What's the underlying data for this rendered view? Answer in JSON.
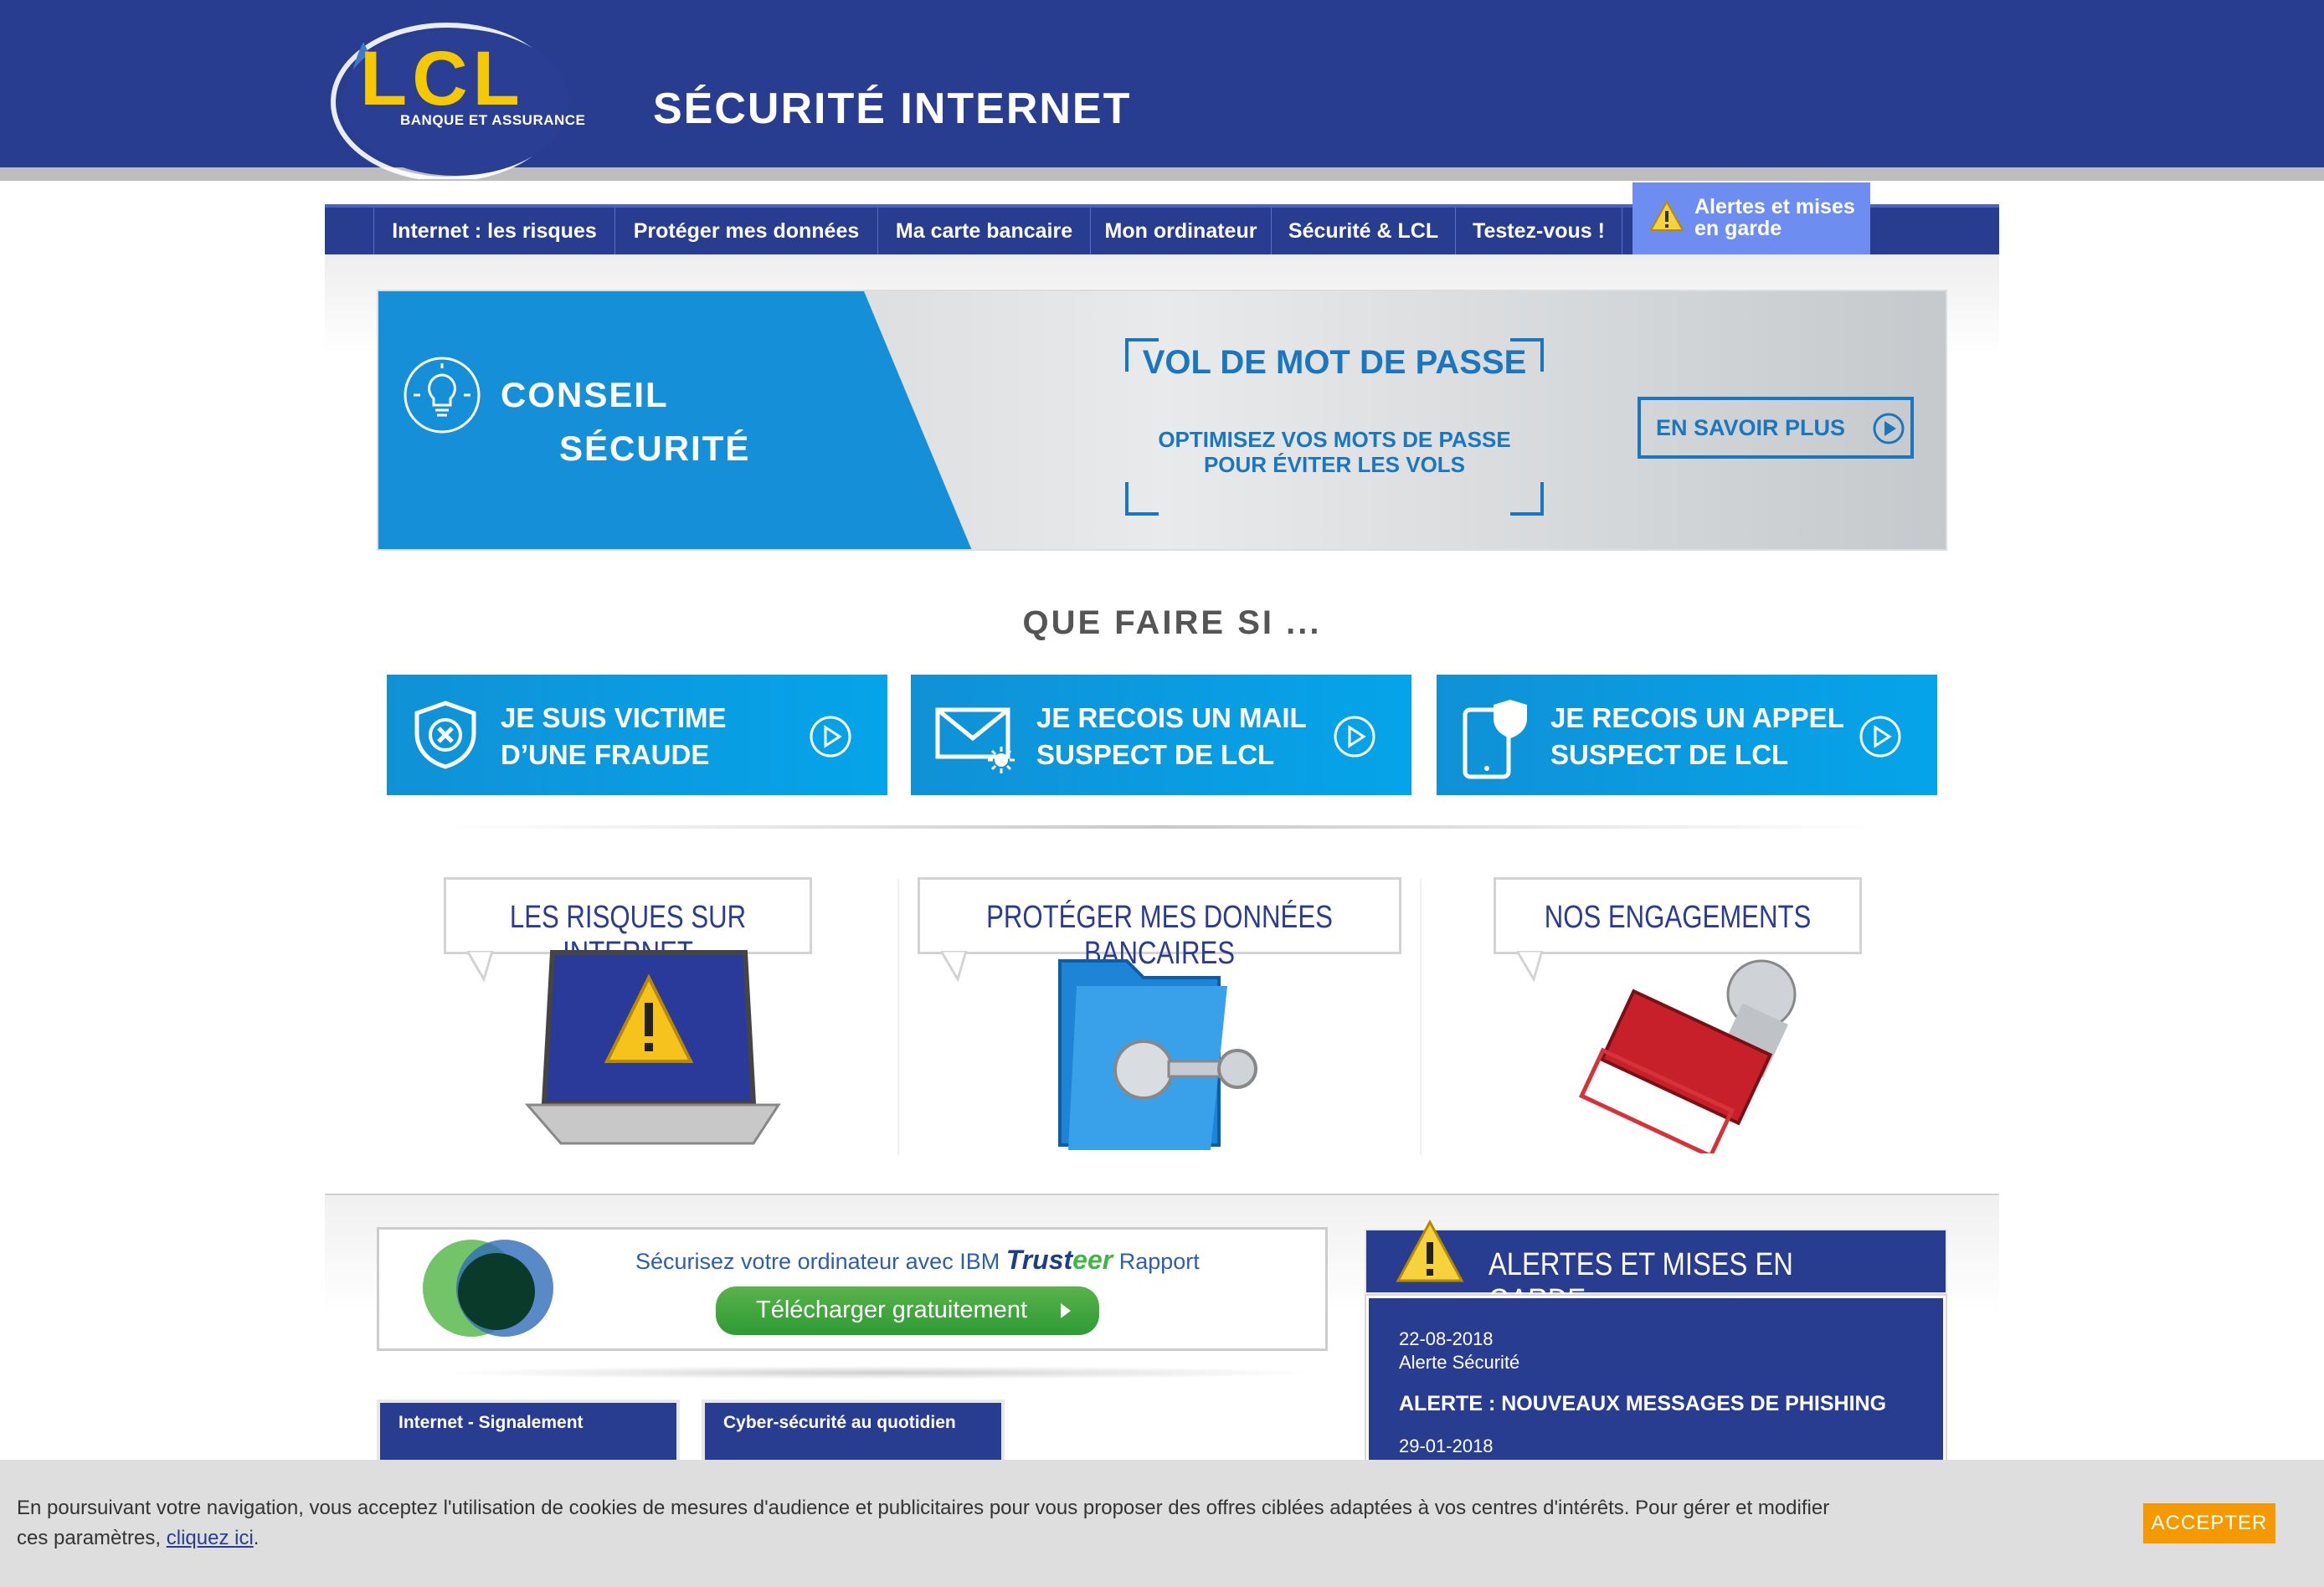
{
  "header": {
    "logo_text": "LCL",
    "logo_subtitle": "BANQUE ET ASSURANCE",
    "title": "SÉCURITÉ INTERNET"
  },
  "nav": {
    "items": [
      {
        "label": "Internet : les risques"
      },
      {
        "label": "Protéger mes données"
      },
      {
        "label": "Ma carte bancaire"
      },
      {
        "label": "Mon ordinateur"
      },
      {
        "label": "Sécurité & LCL"
      },
      {
        "label": "Testez-vous !"
      }
    ],
    "alert_label": "Alertes et mises en garde"
  },
  "banner": {
    "line1": "CONSEIL",
    "line2": "SÉCURITÉ",
    "headline": "VOL DE MOT DE PASSE",
    "subline": "OPTIMISEZ VOS MOTS DE PASSE POUR ÉVITER LES VOLS",
    "cta": "EN SAVOIR PLUS",
    "colors": {
      "blue": "#148fd8",
      "text_blue": "#1a77bf"
    }
  },
  "que_faire": {
    "title": "QUE FAIRE SI ...",
    "buttons": [
      {
        "line1": "JE SUIS VICTIME",
        "line2": "D’UNE FRAUDE",
        "icon": "shield-x-icon"
      },
      {
        "line1": "JE RECOIS UN MAIL",
        "line2": "SUSPECT DE LCL",
        "icon": "mail-icon"
      },
      {
        "line1": "JE RECOIS UN APPEL",
        "line2": "SUSPECT DE LCL",
        "icon": "phone-shield-icon"
      }
    ]
  },
  "categories": [
    {
      "label": "LES RISQUES SUR INTERNET",
      "icon": "laptop-warning-icon"
    },
    {
      "label": "PROTÉGER MES DONNÉES BANCAIRES",
      "icon": "folder-key-icon"
    },
    {
      "label": "NOS ENGAGEMENTS",
      "icon": "stamp-icon"
    }
  ],
  "trusteer": {
    "text": "Sécurisez votre ordinateur avec IBM",
    "brand": "Trust",
    "brand_accent": "eer",
    "product": "Rapport",
    "button": "Télécharger gratuitement"
  },
  "bottom_boxes": [
    {
      "label": "Internet - Signalement"
    },
    {
      "label": "Cyber-sécurité au quotidien"
    }
  ],
  "alerts": {
    "title": "ALERTES ET MISES EN GARDE",
    "items": [
      {
        "date": "22-08-2018",
        "category": "Alerte Sécurité",
        "headline": "ALERTE : NOUVEAUX MESSAGES DE PHISHING"
      },
      {
        "date": "29-01-2018"
      }
    ]
  },
  "cookie": {
    "text": "En poursuivant votre navigation, vous acceptez l'utilisation de cookies de mesures d'audience et publicitaires pour vous proposer des offres ciblées adaptées à vos centres d'intérêts. Pour gérer et modifier ces paramètres, ",
    "link": "cliquez ici",
    "end": ".",
    "button": "ACCEPTER"
  },
  "colors": {
    "brand_navy": "#283d8f",
    "brand_yellow": "#f5c800",
    "accent_orange": "#f49a00",
    "nav_alert": "#6d8ef0"
  }
}
